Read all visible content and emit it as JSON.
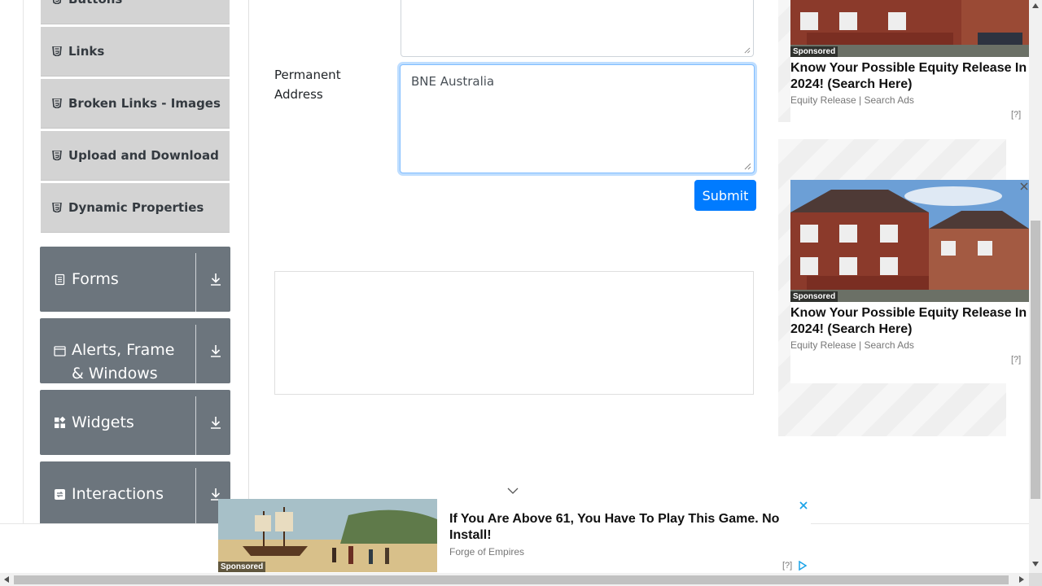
{
  "sidebar": {
    "items": [
      {
        "label": "Buttons",
        "icon": "html5-icon"
      },
      {
        "label": "Links",
        "icon": "html5-icon"
      },
      {
        "label": "Broken Links - Images",
        "icon": "html5-icon"
      },
      {
        "label": "Upload and Download",
        "icon": "html5-icon"
      },
      {
        "label": "Dynamic Properties",
        "icon": "html5-icon"
      }
    ],
    "groups": [
      {
        "title": "Forms",
        "icon": "document-icon"
      },
      {
        "title": "Alerts, Frame & Windows",
        "icon": "window-icon"
      },
      {
        "title": "Widgets",
        "icon": "widgets-icon"
      },
      {
        "title": "Interactions",
        "icon": "interactions-icon"
      }
    ]
  },
  "form": {
    "permanent_address_label_line1": "Permanent",
    "permanent_address_label_line2": "Address",
    "permanent_address_value": "BNE Australia",
    "current_address_value": "",
    "submit_label": "Submit"
  },
  "ads": {
    "right": [
      {
        "headline": "Know Your Possible Equity Release In 2024! (Search Here)",
        "source": "Equity Release | Search Ads",
        "sponsored": "Sponsored",
        "info": "[?]"
      },
      {
        "headline": "Know Your Possible Equity Release In 2024! (Search Here)",
        "source": "Equity Release | Search Ads",
        "sponsored": "Sponsored",
        "info": "[?]"
      }
    ],
    "bottom": {
      "headline": "If You Are Above 61, You Have To Play This Game. No Install!",
      "source": "Forge of Empires",
      "sponsored": "Sponsored",
      "info": "[?]"
    }
  },
  "colors": {
    "primary": "#007bff",
    "group_bg": "#6c757d",
    "item_bg": "#d3d3d3"
  }
}
